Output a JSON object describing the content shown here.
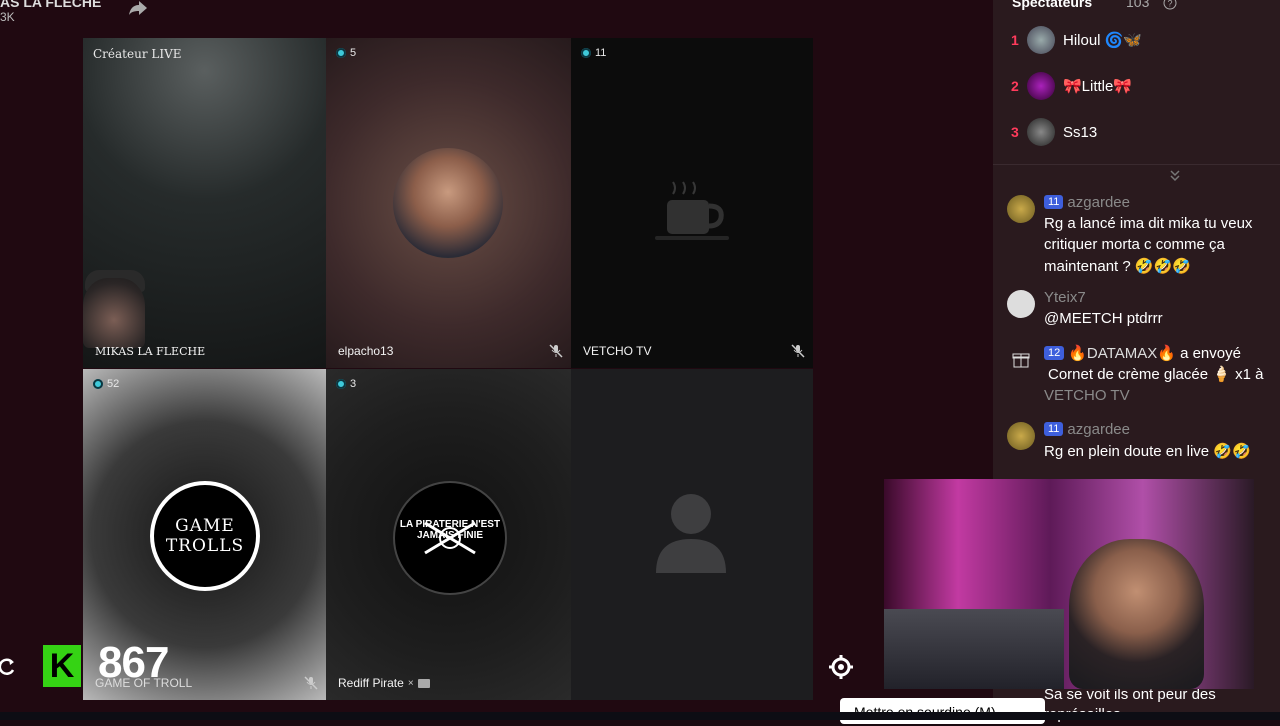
{
  "header": {
    "host_name": "AS LA FLECHE",
    "host_followers": "3K"
  },
  "tiles": [
    {
      "label": "Créateur LIVE",
      "name": "MIKAS LA FLECHE"
    },
    {
      "viewers": "5",
      "name": "elpacho13"
    },
    {
      "viewers": "11",
      "name": "VETCHO TV"
    },
    {
      "viewers": "52",
      "name": "GAME OF TROLL",
      "logo_line1": "GAME",
      "logo_line2": "TROLLS"
    },
    {
      "viewers": "3",
      "name": "Rediff Pirate",
      "logo": "LA PIRATERIE N'EST JAMAIS FINIE"
    },
    {
      "name": ""
    }
  ],
  "overlay": {
    "k_logo": "K",
    "k_count": "867",
    "mute_tooltip": "Mettre en sourdine (M)"
  },
  "spectators": {
    "title": "Spectateurs",
    "count": "103",
    "list": [
      {
        "rank": "1",
        "name": "Hiloul 🌀🦋"
      },
      {
        "rank": "2",
        "name": "🎀Little🎀"
      },
      {
        "rank": "3",
        "name": "Ss13"
      }
    ]
  },
  "chat": [
    {
      "level": "11",
      "user": "azgardee",
      "line1": "Rg a lancé ima dit mika tu veux",
      "line2": "critiquer morta c comme ça",
      "line3": "maintenant ? 🤣🤣🤣"
    },
    {
      "user": "Yteix7",
      "line1": "@MEETCH ptdrrr"
    },
    {
      "level": "12",
      "user": "🔥DATAMAX🔥",
      "action": "a envoyé",
      "line2": "Cornet de crème glacée 🍦 x1 à",
      "line3": "VETCHO TV"
    },
    {
      "level": "11",
      "user": "azgardee",
      "line1": "Rg en plein doute en live 🤣🤣"
    },
    {
      "line1": "Sa se voit ils ont peur des",
      "line2": "représailles"
    }
  ],
  "colors": {
    "accent_kick": "#35d314",
    "rank_red": "#ff3b5c",
    "level_badge": "#3e5fdc",
    "viewer_dot": "#3fc9d9"
  }
}
